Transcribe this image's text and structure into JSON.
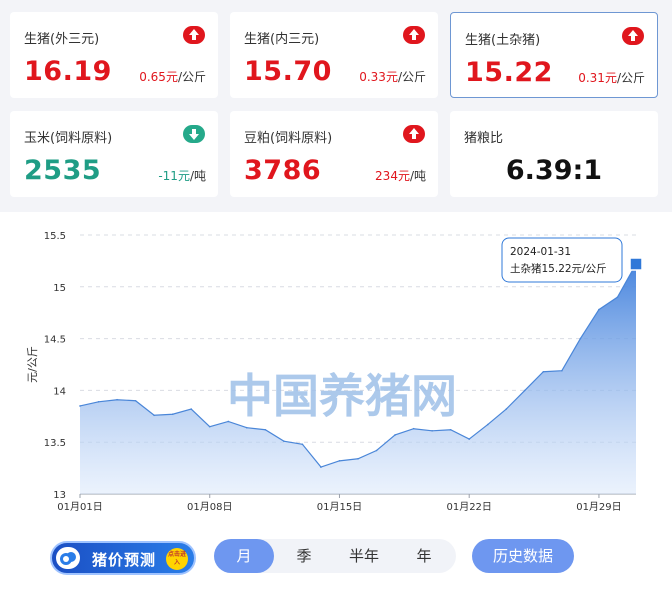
{
  "cards": [
    {
      "name": "生猪(外三元)",
      "price": "16.19",
      "change": "0.65元",
      "unit": "/公斤",
      "dir": "up"
    },
    {
      "name": "生猪(内三元)",
      "price": "15.70",
      "change": "0.33元",
      "unit": "/公斤",
      "dir": "up"
    },
    {
      "name": "生猪(土杂猪)",
      "price": "15.22",
      "change": "0.31元",
      "unit": "/公斤",
      "dir": "up"
    },
    {
      "name": "玉米(饲料原料)",
      "price": "2535",
      "change": "-11元",
      "unit": "/吨",
      "dir": "down"
    },
    {
      "name": "豆粕(饲料原料)",
      "price": "3786",
      "change": "234元",
      "unit": "/吨",
      "dir": "up"
    },
    {
      "name": "猪粮比",
      "price": "6.39:1"
    }
  ],
  "chart_data": {
    "type": "area",
    "ylabel": "元/公斤",
    "ylim": [
      13,
      15.5
    ],
    "yticks": [
      13,
      13.5,
      14,
      14.5,
      15,
      15.5
    ],
    "xtick_labels": [
      "01月01日",
      "01月08日",
      "01月15日",
      "01月22日",
      "01月29日"
    ],
    "watermark": "中国养猪网",
    "tooltip": {
      "date": "2024-01-31",
      "text": "土杂猪15.22元/公斤"
    },
    "x": [
      "2024-01-01",
      "2024-01-02",
      "2024-01-03",
      "2024-01-04",
      "2024-01-05",
      "2024-01-06",
      "2024-01-07",
      "2024-01-08",
      "2024-01-09",
      "2024-01-10",
      "2024-01-11",
      "2024-01-12",
      "2024-01-13",
      "2024-01-14",
      "2024-01-15",
      "2024-01-16",
      "2024-01-17",
      "2024-01-18",
      "2024-01-19",
      "2024-01-20",
      "2024-01-21",
      "2024-01-22",
      "2024-01-23",
      "2024-01-24",
      "2024-01-25",
      "2024-01-26",
      "2024-01-27",
      "2024-01-28",
      "2024-01-29",
      "2024-01-30",
      "2024-01-31"
    ],
    "series": [
      {
        "values": [
          13.85,
          13.89,
          13.91,
          13.9,
          13.76,
          13.77,
          13.82,
          13.65,
          13.7,
          13.64,
          13.62,
          13.51,
          13.48,
          13.26,
          13.32,
          13.34,
          13.42,
          13.57,
          13.63,
          13.61,
          13.62,
          13.53,
          13.67,
          13.82,
          14.0,
          14.18,
          14.19,
          14.5,
          14.78,
          14.9,
          15.22
        ]
      }
    ]
  },
  "bottom": {
    "predict_label": "猪价预测",
    "badge_text": "点击进入",
    "periods": [
      "月",
      "季",
      "半年",
      "年"
    ],
    "selected_period": "月",
    "history_label": "历史数据"
  },
  "colors": {
    "up": "#e0161d",
    "down": "#1f9d85",
    "accent": "#6e97f0",
    "line": "#4a86d8"
  }
}
